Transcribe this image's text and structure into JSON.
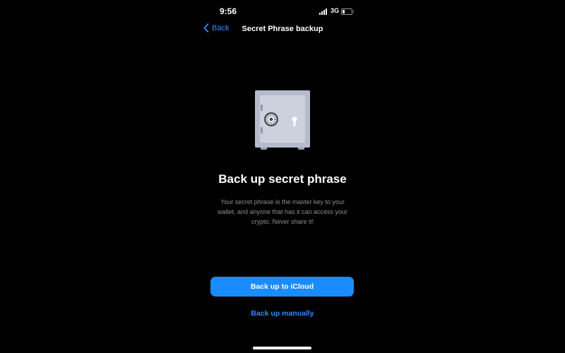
{
  "status_bar": {
    "time": "9:56",
    "network": "3G"
  },
  "nav": {
    "back_label": "Back",
    "title": "Secret Phrase backup"
  },
  "illustration": {
    "icon": "safe-icon"
  },
  "main": {
    "heading": "Back up secret phrase",
    "description": "Your secret phrase is the master key to your wallet, and anyone that has it can access your crypto. Never share it!"
  },
  "actions": {
    "primary_label": "Back up to iCloud",
    "secondary_label": "Back up manually"
  },
  "colors": {
    "accent": "#1a8cff",
    "link": "#2d8cff",
    "background": "#000000",
    "muted_text": "#8e8e93"
  }
}
